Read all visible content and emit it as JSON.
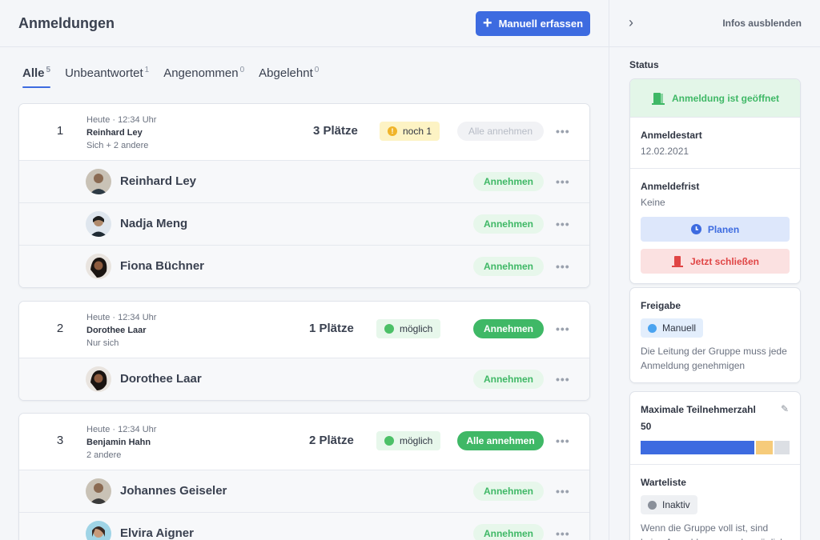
{
  "header": {
    "title": "Anmeldungen",
    "manual_button": "Manuell erfassen"
  },
  "tabs": [
    {
      "label": "Alle",
      "count": "5"
    },
    {
      "label": "Unbeantwortet",
      "count": "1"
    },
    {
      "label": "Angenommen",
      "count": "0"
    },
    {
      "label": "Abgelehnt",
      "count": "0"
    }
  ],
  "groups": [
    {
      "num": "1",
      "time": "Heute · 12:34 Uhr",
      "name": "Reinhard Ley",
      "sub": "Sich + 2 andere",
      "places": "3 Plätze",
      "badge": "noch 1",
      "badge_icon": "!",
      "action": "Alle annehmen",
      "people": [
        {
          "name": "Reinhard Ley",
          "action": "Annehmen"
        },
        {
          "name": "Nadja Meng",
          "action": "Annehmen"
        },
        {
          "name": "Fiona Büchner",
          "action": "Annehmen"
        }
      ]
    },
    {
      "num": "2",
      "time": "Heute · 12:34 Uhr",
      "name": "Dorothee Laar",
      "sub": "Nur sich",
      "places": "1 Plätze",
      "badge": "möglich",
      "action": "Annehmen",
      "people": [
        {
          "name": "Dorothee Laar",
          "action": "Annehmen"
        }
      ]
    },
    {
      "num": "3",
      "time": "Heute · 12:34 Uhr",
      "name": "Benjamin Hahn",
      "sub": "2 andere",
      "places": "2 Plätze",
      "badge": "möglich",
      "action": "Alle annehmen",
      "people": [
        {
          "name": "Johannes Geiseler",
          "action": "Annehmen"
        },
        {
          "name": "Elvira Aigner",
          "action": "Annehmen"
        }
      ]
    }
  ],
  "more_glyph": "•••",
  "sidebar": {
    "hide_label": "Infos ausblenden",
    "status_label": "Status",
    "open_banner": "Anmeldung ist geöffnet",
    "start_title": "Anmeldestart",
    "start_value": "12.02.2021",
    "deadline_title": "Anmeldefrist",
    "deadline_value": "Keine",
    "plan_button": "Planen",
    "close_button": "Jetzt schließen",
    "release_title": "Freigabe",
    "release_chip": "Manuell",
    "release_text": "Die Leitung der Gruppe muss jede Anmeldung genehmigen",
    "max_title": "Maximale Teilnehmerzahl",
    "max_value": "50",
    "waitlist_title": "Warteliste",
    "waitlist_chip": "Inaktiv",
    "waitlist_text": "Wenn die Gruppe voll ist,  sind keine Anmeldungen mehr möglich"
  },
  "capacity": {
    "max": 50,
    "accepted_fraction": 0.75,
    "pending_fraction": 0.11,
    "free_fraction": 0.1
  },
  "colors": {
    "accent": "#3d6be0",
    "success": "#3fb866",
    "danger": "#e04545",
    "warning": "#f0b429"
  }
}
